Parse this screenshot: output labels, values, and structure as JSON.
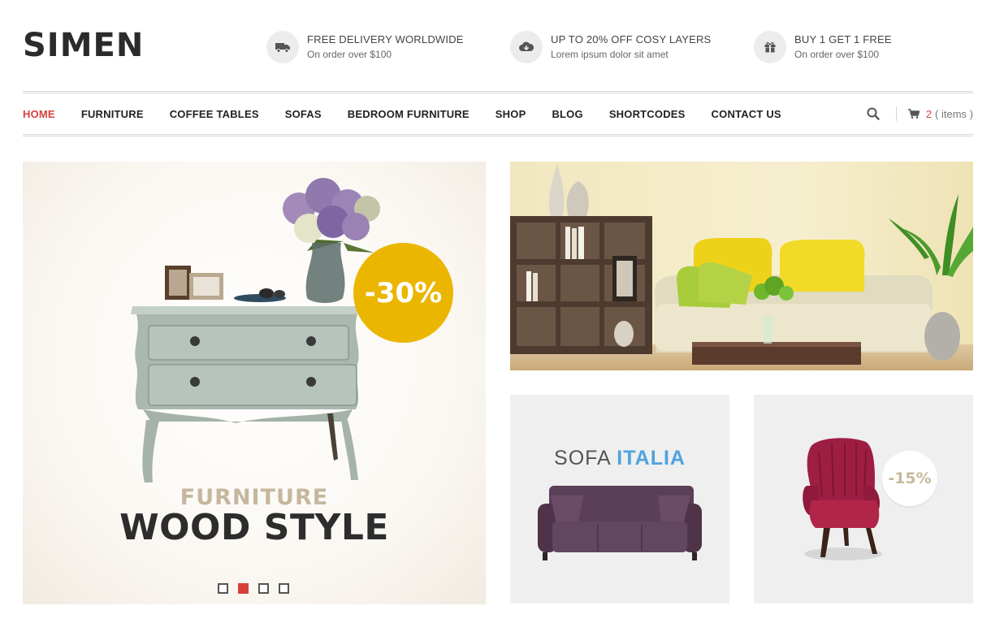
{
  "brand": {
    "logo": "SIMEN"
  },
  "promos": [
    {
      "title": "FREE DELIVERY WORLDWIDE",
      "subtitle": "On order over $100",
      "icon": "truck-icon"
    },
    {
      "title": "UP TO 20% OFF COSY LAYERS",
      "subtitle": "Lorem ipsum dolor sit amet",
      "icon": "cloud-download-icon"
    },
    {
      "title": "BUY 1 GET 1 FREE",
      "subtitle": "On order over $100",
      "icon": "gift-icon"
    }
  ],
  "nav": {
    "items": [
      {
        "label": "HOME",
        "active": true
      },
      {
        "label": "FURNITURE"
      },
      {
        "label": "COFFEE TABLES"
      },
      {
        "label": "SOFAS"
      },
      {
        "label": "BEDROOM FURNITURE"
      },
      {
        "label": "SHOP"
      },
      {
        "label": "BLOG"
      },
      {
        "label": "SHORTCODES"
      },
      {
        "label": "CONTACT US"
      }
    ],
    "cart": {
      "count": "2",
      "label": "( items )"
    }
  },
  "hero": {
    "discount": "-30%",
    "headline_top": "FURNITURE",
    "headline_bottom": "WOOD STYLE",
    "slide_count": 4,
    "active_slide": 2
  },
  "banners": {
    "sofa": {
      "title_plain": "SOFA ",
      "title_accent": "ITALIA"
    },
    "chair": {
      "discount": "-15%"
    }
  },
  "colors": {
    "accent": "#d8403e",
    "hero_badge": "#ebb600",
    "sofa_accent": "#4fa3dd"
  }
}
